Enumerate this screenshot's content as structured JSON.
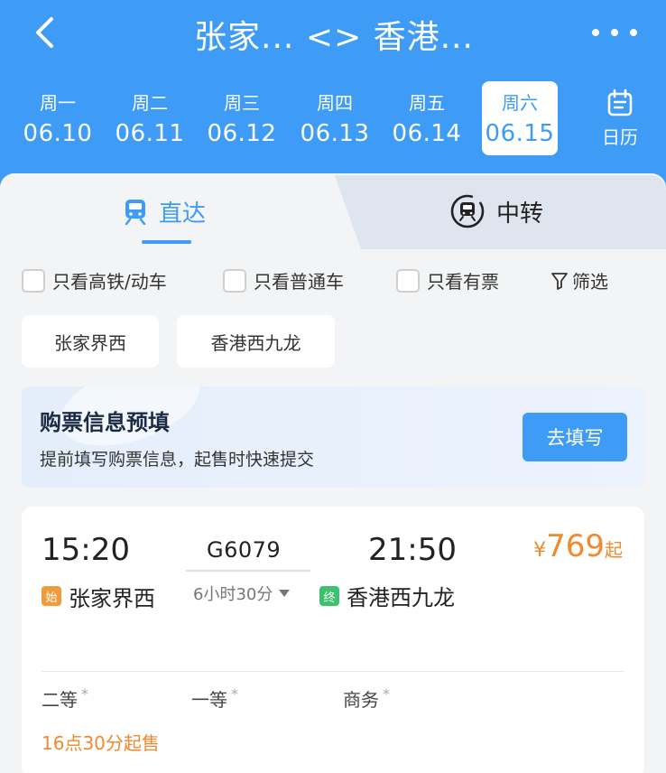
{
  "header": {
    "title": "张家... <> 香港...",
    "calendar_label": "日历"
  },
  "dates": [
    {
      "weekday": "周一",
      "date": "06.10",
      "active": false
    },
    {
      "weekday": "周二",
      "date": "06.11",
      "active": false
    },
    {
      "weekday": "周三",
      "date": "06.12",
      "active": false
    },
    {
      "weekday": "周四",
      "date": "06.13",
      "active": false
    },
    {
      "weekday": "周五",
      "date": "06.14",
      "active": false
    },
    {
      "weekday": "周六",
      "date": "06.15",
      "active": true
    }
  ],
  "tabs": {
    "direct": "直达",
    "transfer": "中转"
  },
  "filters": {
    "high_speed": "只看高铁/动车",
    "normal": "只看普通车",
    "available": "只看有票",
    "filter": "筛选"
  },
  "stations": {
    "from": "张家界西",
    "to": "香港西九龙"
  },
  "banner": {
    "title": "购票信息预填",
    "subtitle": "提前填写购票信息，起售时快速提交",
    "button": "去填写"
  },
  "train": {
    "departure_time": "15:20",
    "arrival_time": "21:50",
    "number": "G6079",
    "duration": "6小时30分",
    "start_badge": "始",
    "end_badge": "终",
    "departure_station": "张家界西",
    "arrival_station": "香港西九龙",
    "price_currency": "¥",
    "price_value": "769",
    "price_suffix": "起",
    "seats": [
      {
        "name": "二等",
        "mark": "*"
      },
      {
        "name": "一等",
        "mark": "*"
      },
      {
        "name": "商务",
        "mark": "*"
      }
    ],
    "sale_info": "16点30分起售"
  },
  "colors": {
    "primary": "#3e9cf6",
    "price": "#f0892f",
    "start_badge": "#f19a3c",
    "end_badge": "#3cc26e"
  }
}
